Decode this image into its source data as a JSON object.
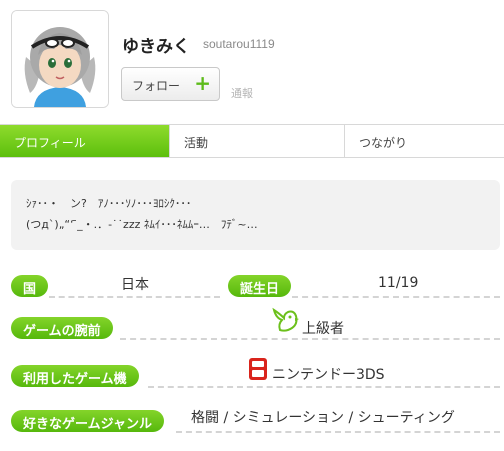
{
  "profile": {
    "name": "ゆきみく",
    "user_id": "soutarou1119",
    "follow_label": "フォロー",
    "follow_icon": "+",
    "report_label": "通報"
  },
  "tabs": [
    {
      "label": "プロフィール",
      "active": true
    },
    {
      "label": "活動",
      "active": false
    },
    {
      "label": "つながり",
      "active": false
    }
  ],
  "bio": {
    "line1": "ｼｧ･･・　ン?　ｱﾉ･･･ｿﾉ･･･ﾖﾛｼｸ･･･",
    "line2": "(つд`)„“‘ ̄_・.．-˙˙zzz ﾈﾑｲ･･･ﾈﾑﾑｰ…　ﾌﾃﾞ~…"
  },
  "fields": {
    "country": {
      "label": "国",
      "value": "日本"
    },
    "birthday": {
      "label": "誕生日",
      "value": "11/19"
    },
    "skill": {
      "label": "ゲームの腕前",
      "value": "上級者",
      "icon": "bird-icon"
    },
    "system": {
      "label": "利用したゲーム機",
      "value": "ニンテンドー3DS",
      "icon": "3ds-icon"
    },
    "genre": {
      "label": "好きなゲームジャンル",
      "value": "格闘 / シミュレーション / シューティング"
    }
  },
  "colors": {
    "accent_green": "#5cbf0d",
    "tab_active_top": "#8fdb2d",
    "ds_red": "#d9241c"
  }
}
